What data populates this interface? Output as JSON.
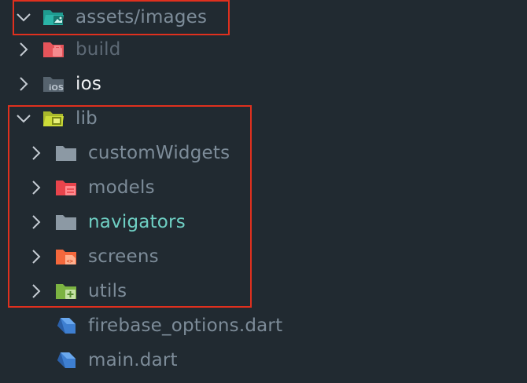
{
  "explorer": {
    "items": [
      {
        "label": "assets/images",
        "expanded": true,
        "icon": "folder-images-open-icon",
        "color": "#7d8c99"
      },
      {
        "label": "build",
        "expanded": false,
        "icon": "folder-build-icon",
        "color": "#5d6975"
      },
      {
        "label": "ios",
        "expanded": false,
        "icon": "folder-ios-icon",
        "color": "#f1f3f5"
      },
      {
        "label": "lib",
        "expanded": true,
        "icon": "folder-lib-open-icon",
        "color": "#7d8c99"
      },
      {
        "label": "customWidgets",
        "expanded": false,
        "icon": "folder-icon",
        "color": "#7d8c99"
      },
      {
        "label": "models",
        "expanded": false,
        "icon": "folder-models-icon",
        "color": "#7d8c99"
      },
      {
        "label": "navigators",
        "expanded": false,
        "icon": "folder-icon",
        "color": "#6fd0c4"
      },
      {
        "label": "screens",
        "expanded": false,
        "icon": "folder-screens-icon",
        "color": "#7d8c99"
      },
      {
        "label": "utils",
        "expanded": false,
        "icon": "folder-utils-icon",
        "color": "#7d8c99"
      },
      {
        "label": "firebase_options.dart",
        "icon": "dart-file-icon",
        "color": "#7d8c99"
      },
      {
        "label": "main.dart",
        "icon": "dart-file-icon",
        "color": "#7d8c99"
      }
    ]
  },
  "colors": {
    "background": "#212a31",
    "highlight_border": "#e0301e"
  }
}
